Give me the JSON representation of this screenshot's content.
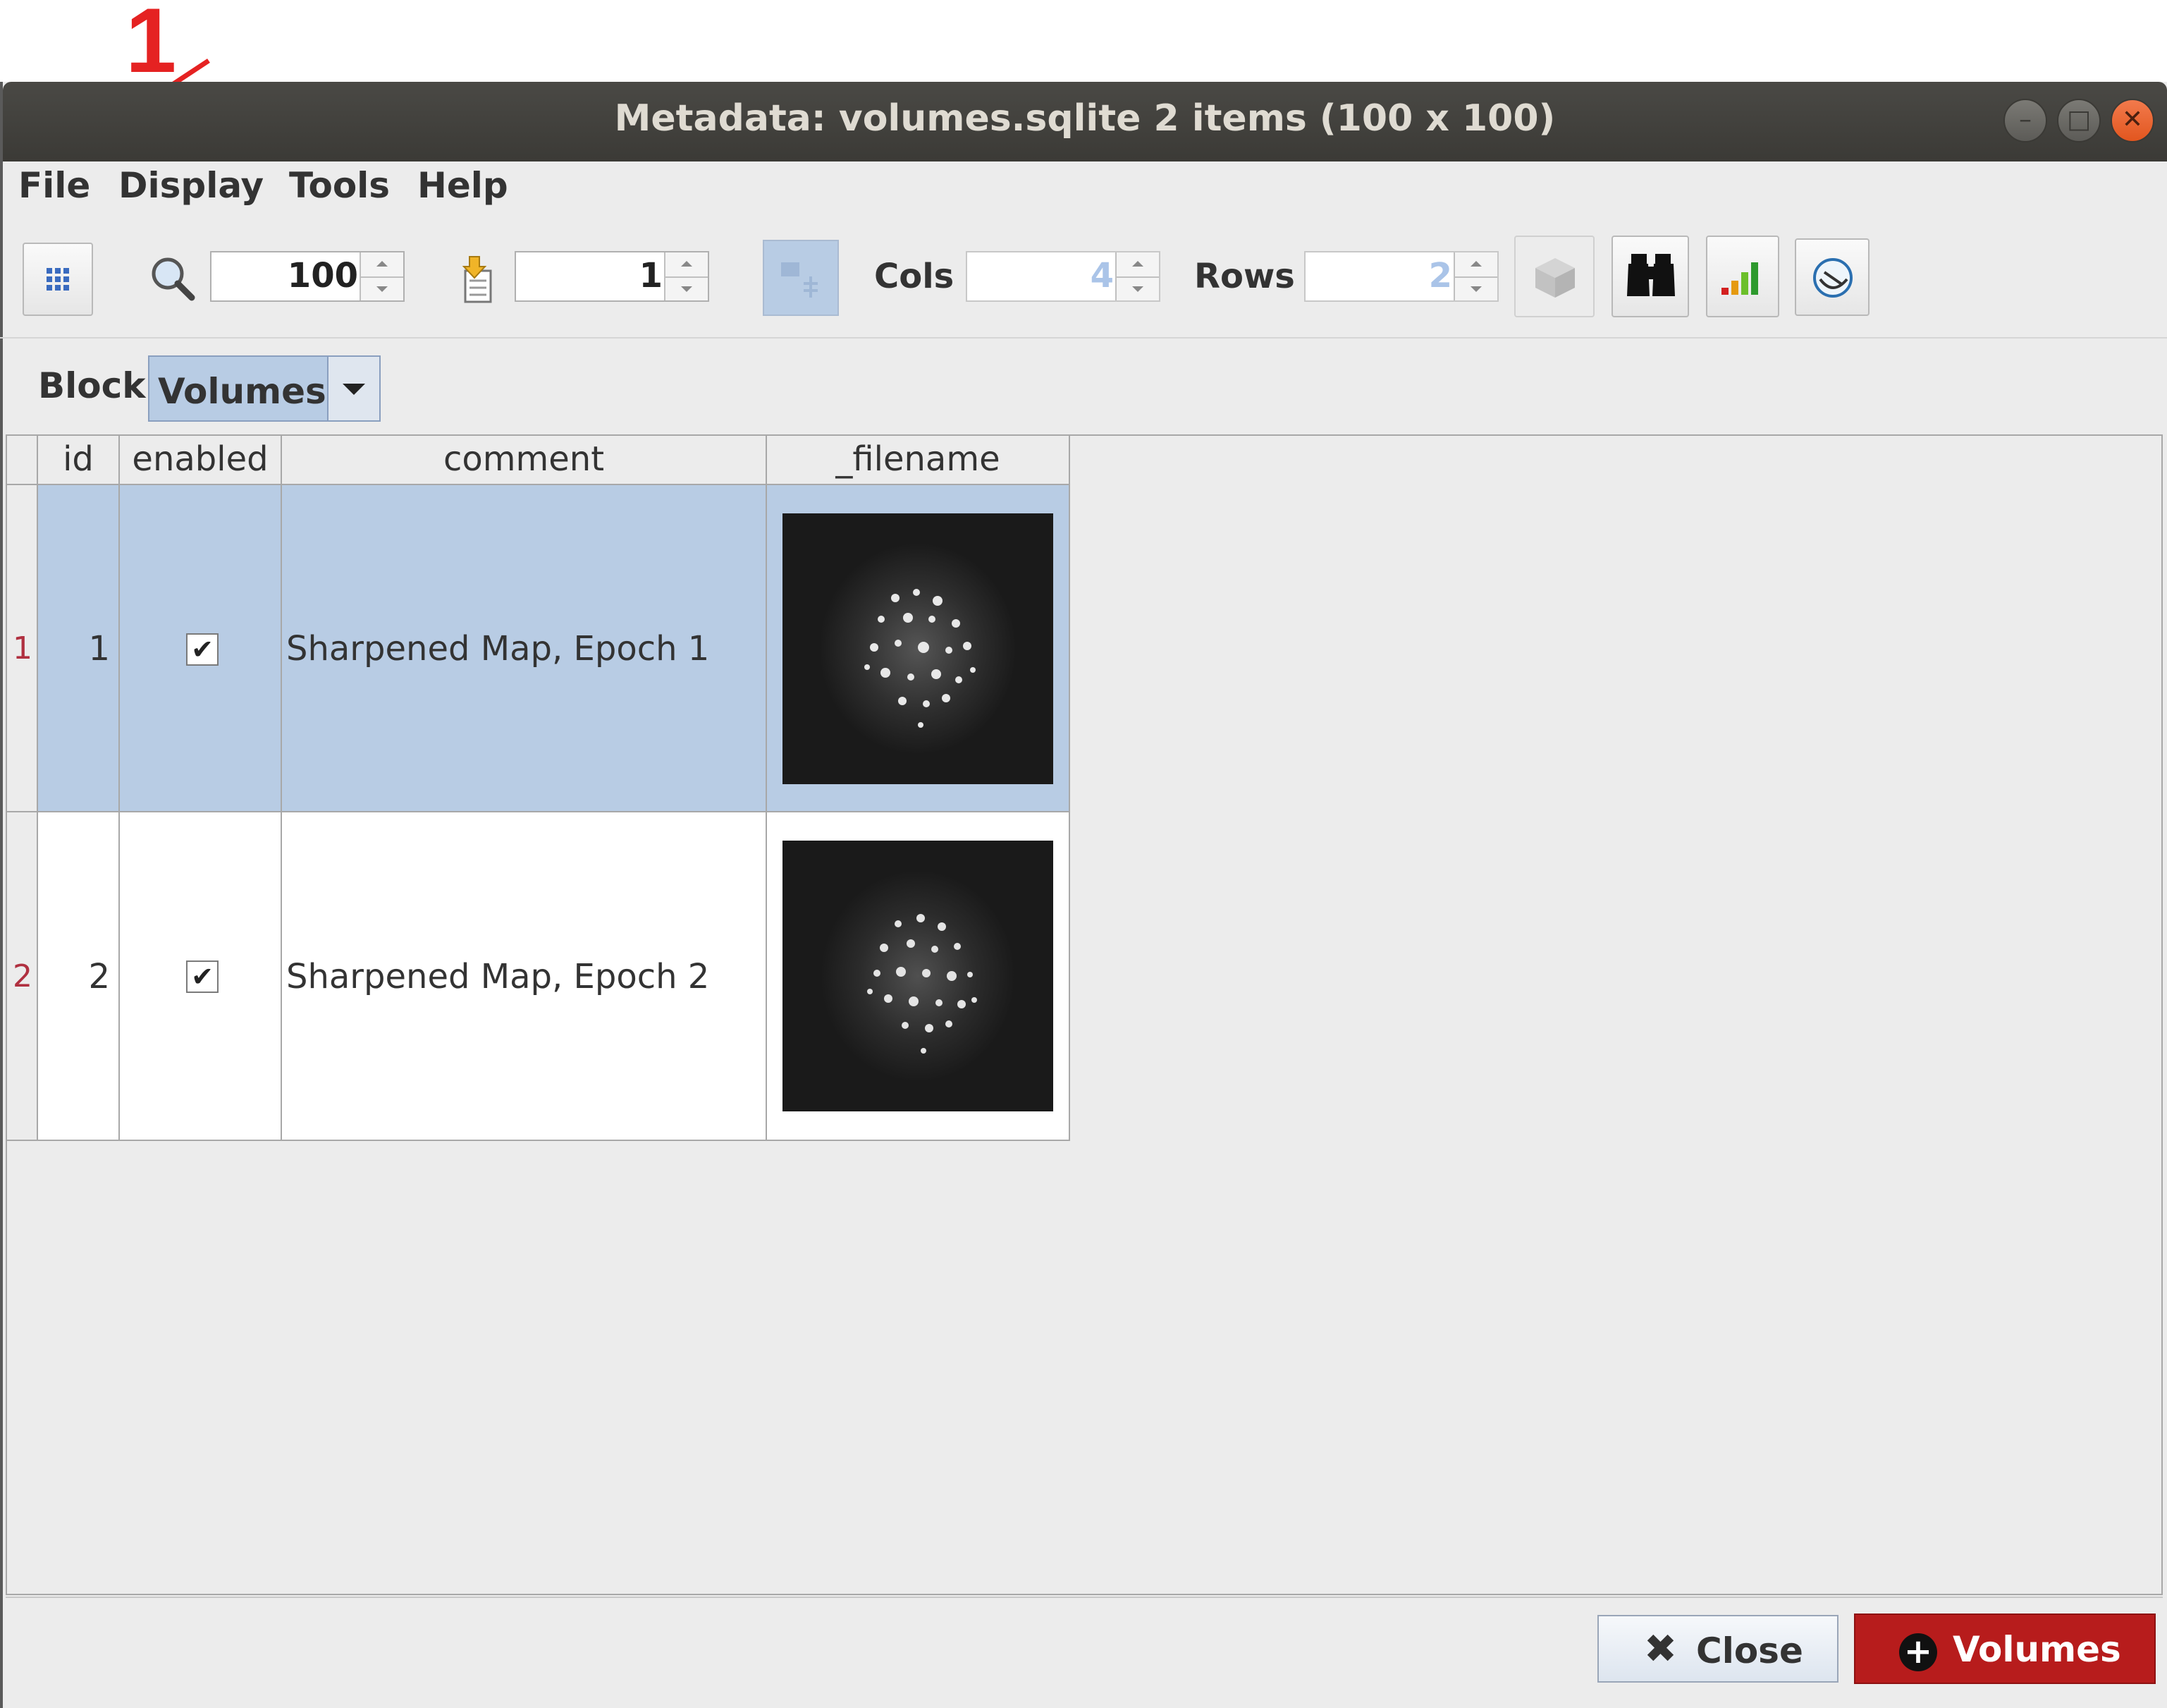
{
  "annotation": {
    "step_number": "1",
    "color": "#e52222"
  },
  "window": {
    "title": "Metadata: volumes.sqlite 2 items (100 x 100)",
    "controls": [
      "minimize-icon",
      "maximize-icon",
      "close-icon"
    ]
  },
  "menu": {
    "file": "File",
    "display": "Display",
    "tools": "Tools",
    "help": "Help"
  },
  "toolbar": {
    "zoom_value": "100",
    "goto_value": "1",
    "cols_label": "Cols",
    "cols_value": "4",
    "rows_label": "Rows",
    "rows_value": "2",
    "icons": [
      "grid-view-icon",
      "zoom-icon",
      "goto-item-icon",
      "table-view-icon",
      "3d-view-icon",
      "find-icon",
      "plot-icon",
      "refresh-icon"
    ]
  },
  "block": {
    "label": "Block",
    "selected": "Volumes"
  },
  "table": {
    "headers": [
      "id",
      "enabled",
      "comment",
      "_filename"
    ],
    "rows": [
      {
        "row_num": "1",
        "id": "1",
        "enabled": true,
        "comment": "Sharpened Map,  Epoch 1",
        "selected": true
      },
      {
        "row_num": "2",
        "id": "2",
        "enabled": true,
        "comment": "Sharpened Map,  Epoch 2",
        "selected": false
      }
    ]
  },
  "buttons": {
    "close": "Close",
    "volumes": "Volumes"
  },
  "colors": {
    "selection": "#b8cce4",
    "volumes_button": "#b71c1c"
  }
}
